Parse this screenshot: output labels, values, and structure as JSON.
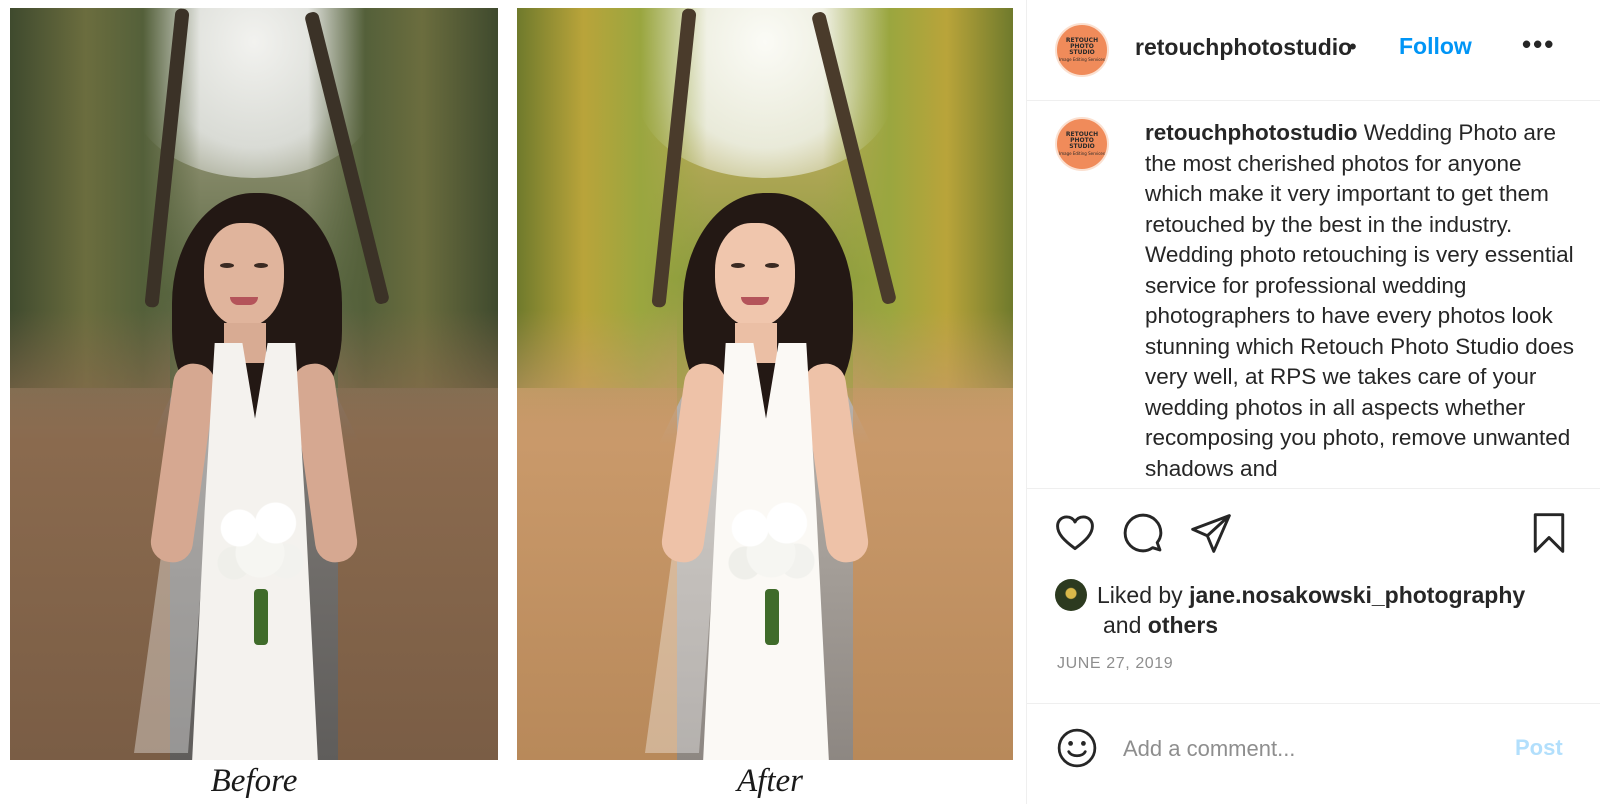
{
  "media": {
    "labels": {
      "before": "Before",
      "after": "After"
    }
  },
  "header": {
    "avatar_text": [
      "RETOUCH",
      "PHOTO",
      "STUDIO",
      "Image Editing Services"
    ],
    "username": "retouchphotostudio",
    "dot": "•",
    "follow_label": "Follow",
    "more_label": "•••"
  },
  "caption": {
    "username": "retouchphotostudio",
    "text": "Wedding Photo are the most cherished photos for anyone which make it very important to get them retouched by the best in the industry. Wedding photo retouching is very essential service for professional wedding photographers to have every photos look stunning which Retouch Photo Studio does very well, at RPS we takes care of your wedding photos in all aspects whether recomposing you photo, remove unwanted shadows and"
  },
  "actions": {
    "icons": [
      "heart-icon",
      "comment-icon",
      "share-icon",
      "bookmark-icon"
    ]
  },
  "likes": {
    "prefix": "Liked by",
    "user": "jane.nosakowski_photography",
    "conjunction": "and",
    "others": "others"
  },
  "date": "JUNE 27, 2019",
  "comment_box": {
    "placeholder": "Add a comment...",
    "post_label": "Post"
  },
  "colors": {
    "accent": "#0095f6",
    "post_disabled": "#b2dffc",
    "muted": "#8e8e8e",
    "text": "#262626",
    "avatar": "#f08b5a"
  }
}
